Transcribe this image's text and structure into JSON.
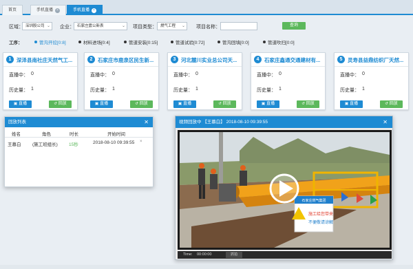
{
  "tabs": [
    {
      "label": "首页",
      "active": false,
      "closable": false
    },
    {
      "label": "手机直播",
      "active": false,
      "closable": true
    },
    {
      "label": "手机直播",
      "active": true,
      "closable": true
    }
  ],
  "filters": {
    "region_label": "区域：",
    "region_value": "深圳股公司",
    "company_label": "企业：",
    "company_value": "石家庄震公新表",
    "project_type_label": "项目类型：",
    "project_type_value": "燃气工程",
    "project_name_label": "项目名称：",
    "project_name_value": "",
    "query_label": "查询"
  },
  "work": {
    "label": "工序：",
    "items": [
      {
        "text": "管沟开挖[0:8]",
        "selected": true
      },
      {
        "text": "材料进场[0:4]",
        "selected": false
      },
      {
        "text": "管道安装[0:15]",
        "selected": false
      },
      {
        "text": "管道试验[0:72]",
        "selected": false
      },
      {
        "text": "管沟回填[0:0]",
        "selected": false
      },
      {
        "text": "管道吹扫[0:0]",
        "selected": false
      }
    ]
  },
  "cards": [
    {
      "num": "1",
      "title": "深泽县南社庄天然气工...",
      "live_label": "直播中：",
      "live_value": "0",
      "history_label": "历史量：",
      "history_value": "1",
      "live_btn": "直播",
      "replay_btn": "回放"
    },
    {
      "num": "2",
      "title": "石家庄市鹿泉区民生新...",
      "live_label": "直播中：",
      "live_value": "0",
      "history_label": "历史量：",
      "history_value": "1",
      "live_btn": "直播",
      "replay_btn": "回放"
    },
    {
      "num": "3",
      "title": "河北麓川实业总公司天...",
      "live_label": "直播中：",
      "live_value": "0",
      "history_label": "历史量：",
      "history_value": "1",
      "live_btn": "直播",
      "replay_btn": "回放"
    },
    {
      "num": "4",
      "title": "石家庄鑫通交通建材有...",
      "live_label": "直播中：",
      "live_value": "0",
      "history_label": "历史量：",
      "history_value": "1",
      "live_btn": "直播",
      "replay_btn": "回放"
    },
    {
      "num": "5",
      "title": "灵寿县益鼎纺织厂天然...",
      "live_label": "直播中：",
      "live_value": "0",
      "history_label": "历史量：",
      "history_value": "1",
      "live_btn": "直播",
      "replay_btn": "回放"
    }
  ],
  "playlist": {
    "title": "回放列表",
    "headers": [
      "姓名",
      "角色",
      "时长",
      "开始时间"
    ],
    "rows": [
      {
        "name": "王慕白",
        "role": "(施工班组长)",
        "duration": "15秒",
        "start": "2018-08-10 09:39:55",
        "action": "×"
      }
    ]
  },
  "video": {
    "title": "视频回放中 【王慕白】 2018-08-10 09:39:55",
    "sign_company": "石家庄燃气集团",
    "sign_line1": "施工给您带来",
    "sign_line2": "不便敬请谅解",
    "time_label": "Time:",
    "time_value": "00:00:00",
    "capture_label": "抓拍"
  },
  "colors": {
    "primary": "#1e8bd3",
    "success": "#5cb85c"
  }
}
